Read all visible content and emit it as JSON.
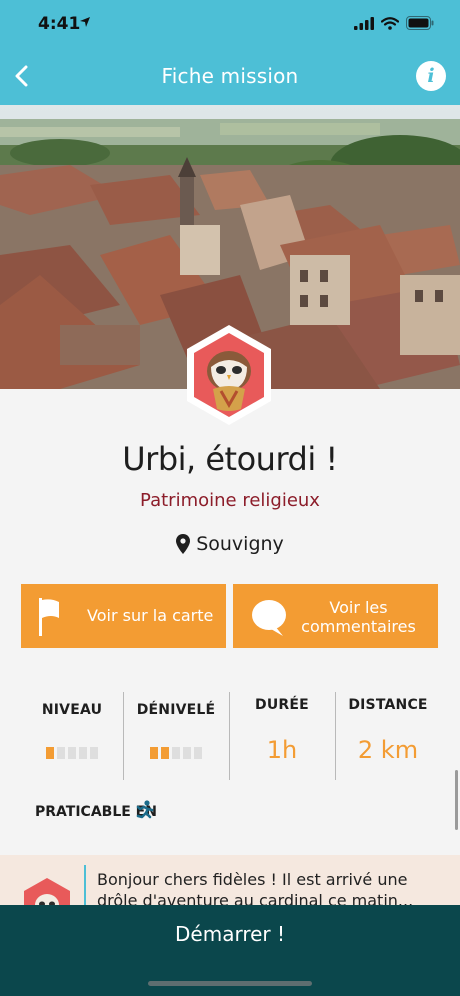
{
  "status_bar": {
    "time": "4:41"
  },
  "nav": {
    "title": "Fiche mission",
    "info_label": "i"
  },
  "mission": {
    "title": "Urbi, étourdi !",
    "category": "Patrimoine religieux",
    "location": "Souvigny"
  },
  "actions": {
    "map_label": "Voir sur la carte",
    "comments_label": "Voir les commentaires"
  },
  "stats": {
    "level": {
      "label": "NIVEAU",
      "rating": 1,
      "max": 5
    },
    "elevation": {
      "label": "DÉNIVELÉ",
      "rating": 2,
      "max": 5
    },
    "duration": {
      "label": "DURÉE",
      "value": "1h"
    },
    "distance": {
      "label": "DISTANCE",
      "value": "2 km"
    }
  },
  "practicable": {
    "label": "PRATICABLE EN",
    "icon": "running-person-icon"
  },
  "message": {
    "text": "Bonjour chers fidèles ! Il est arrivé une drôle d'aventure au cardinal ce matin..."
  },
  "start": {
    "label": "Démarrer !"
  },
  "colors": {
    "header": "#4dbfd6",
    "accent": "#f39c33",
    "category": "#8c1d2a",
    "footer": "#0b474c",
    "badge": "#e85a5a"
  }
}
